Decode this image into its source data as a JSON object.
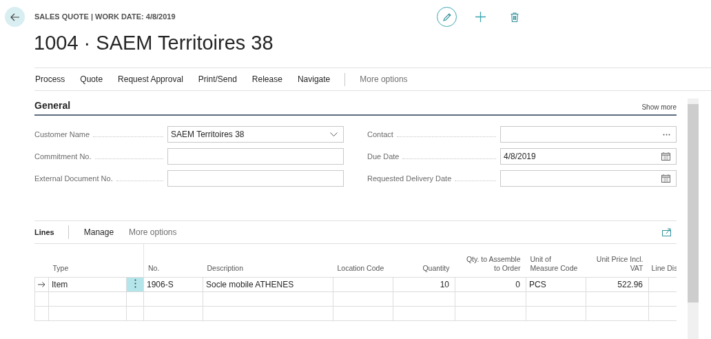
{
  "header": {
    "breadcrumb": "SALES QUOTE | WORK DATE: 4/8/2019",
    "title": "1004 · SAEM Territoires 38"
  },
  "actions": [
    {
      "label": "Process",
      "kind": "menu"
    },
    {
      "label": "Quote",
      "kind": "menu"
    },
    {
      "label": "Request Approval",
      "kind": "menu"
    },
    {
      "label": "Print/Send",
      "kind": "menu"
    },
    {
      "label": "Release",
      "kind": "menu"
    },
    {
      "label": "Navigate",
      "kind": "menu"
    },
    {
      "label": "More options",
      "kind": "more"
    }
  ],
  "general": {
    "title": "General",
    "show_more": "Show more",
    "left_fields": [
      {
        "label": "Customer Name",
        "value": "SAEM Territoires 38",
        "kind": "dropdown"
      },
      {
        "label": "Commitment No.",
        "kind": "text"
      },
      {
        "label": "External Document No.",
        "kind": "text"
      }
    ],
    "right_fields": [
      {
        "label": "Contact",
        "kind": "lookup"
      },
      {
        "label": "Due Date",
        "value": "4/8/2019",
        "kind": "date"
      },
      {
        "label": "Requested Delivery Date",
        "kind": "date"
      }
    ]
  },
  "lines": {
    "title": "Lines",
    "actions": [
      {
        "label": "Manage",
        "kind": "menu"
      },
      {
        "label": "More options",
        "kind": "more"
      }
    ],
    "table": {
      "columns": [
        {
          "label": "Type"
        },
        {
          "label": "No."
        },
        {
          "label": "Description"
        },
        {
          "label": "Location Code"
        },
        {
          "label": "Quantity"
        },
        {
          "label": "Qty. to Assemble to Order"
        },
        {
          "label": "Unit of Measure Code"
        },
        {
          "label": "Unit Price Incl. VAT"
        },
        {
          "label": "Line Dis"
        }
      ],
      "rows": [
        {
          "current": true,
          "type": "Item",
          "no": "1906-S",
          "description": "Socle mobile ATHENES",
          "quantity": "10",
          "qty_to_assemble_to_order": "0",
          "unit_of_measure_code": "PCS",
          "unit_price_incl_vat": "522.96"
        },
        {
          "current": false
        },
        {
          "current": false
        }
      ]
    }
  }
}
